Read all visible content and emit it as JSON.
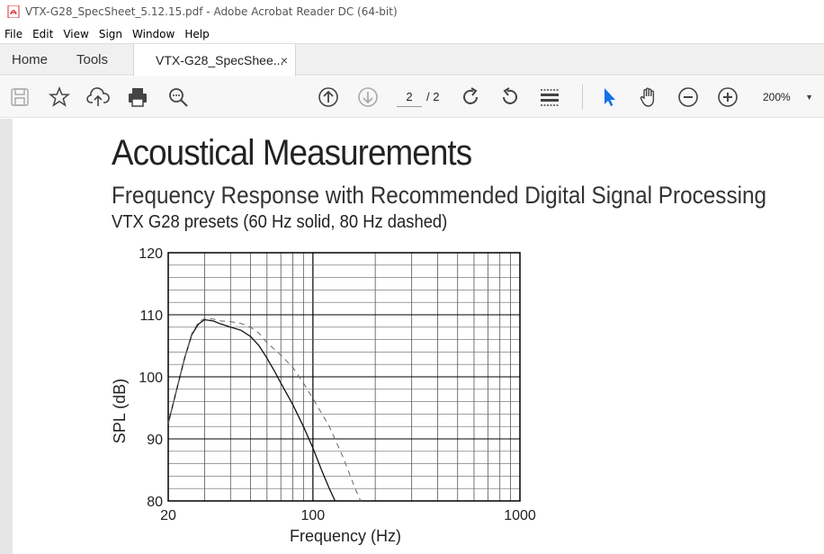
{
  "window": {
    "title": "VTX-G28_SpecSheet_5.12.15.pdf - Adobe Acrobat Reader DC (64-bit)"
  },
  "menu": [
    "File",
    "Edit",
    "View",
    "Sign",
    "Window",
    "Help"
  ],
  "tabs": {
    "home": "Home",
    "tools": "Tools",
    "document": "VTX-G28_SpecShee...",
    "close_glyph": "×"
  },
  "toolbar": {
    "page_current": "2",
    "page_total": "/ 2",
    "zoom": "200%",
    "icons": [
      "save-icon",
      "bookmark-star-icon",
      "upload-cloud-icon",
      "print-icon",
      "find-zoom-icon",
      "prev-page-icon",
      "next-page-icon",
      "rotate-cw-icon",
      "rotate-ccw-icon",
      "scroll-mode-icon",
      "select-cursor-icon",
      "hand-tool-icon",
      "zoom-out-icon",
      "zoom-in-icon"
    ],
    "accent_color": "#1473e6"
  },
  "document": {
    "heading": "Acoustical Measurements",
    "subheading": "Frequency Response with Recommended Digital Signal Processing",
    "caption": "VTX G28 presets (60 Hz solid, 80 Hz dashed)"
  },
  "chart_data": {
    "type": "line",
    "xlabel": "Frequency (Hz)",
    "ylabel": "SPL (dB)",
    "x_scale": "log",
    "xlim": [
      20,
      1000
    ],
    "ylim": [
      80,
      120
    ],
    "x_ticks": [
      "20",
      "100",
      "1000"
    ],
    "y_ticks": [
      "80",
      "90",
      "100",
      "110",
      "120"
    ],
    "grid": true,
    "series": [
      {
        "style": "solid",
        "points": [
          [
            20,
            92.5
          ],
          [
            22,
            98
          ],
          [
            24,
            103
          ],
          [
            26,
            106.8
          ],
          [
            28,
            108.5
          ],
          [
            30,
            109.2
          ],
          [
            33,
            109
          ],
          [
            36,
            108.5
          ],
          [
            40,
            108
          ],
          [
            45,
            107.5
          ],
          [
            50,
            106.5
          ],
          [
            55,
            105
          ],
          [
            60,
            103
          ],
          [
            65,
            101
          ],
          [
            70,
            99
          ],
          [
            80,
            95.5
          ],
          [
            90,
            92
          ],
          [
            100,
            88.5
          ],
          [
            110,
            85
          ],
          [
            120,
            82
          ],
          [
            128,
            80
          ]
        ]
      },
      {
        "style": "dashed",
        "points": [
          [
            20,
            92.5
          ],
          [
            22,
            98
          ],
          [
            24,
            103
          ],
          [
            26,
            107
          ],
          [
            28,
            108.8
          ],
          [
            30,
            109.4
          ],
          [
            33,
            109.3
          ],
          [
            36,
            109
          ],
          [
            40,
            108.9
          ],
          [
            45,
            108.6
          ],
          [
            50,
            108
          ],
          [
            55,
            107
          ],
          [
            60,
            105.5
          ],
          [
            70,
            103.5
          ],
          [
            80,
            101.5
          ],
          [
            90,
            99
          ],
          [
            100,
            96.5
          ],
          [
            120,
            92
          ],
          [
            140,
            87
          ],
          [
            160,
            82
          ],
          [
            170,
            80
          ]
        ]
      }
    ]
  }
}
